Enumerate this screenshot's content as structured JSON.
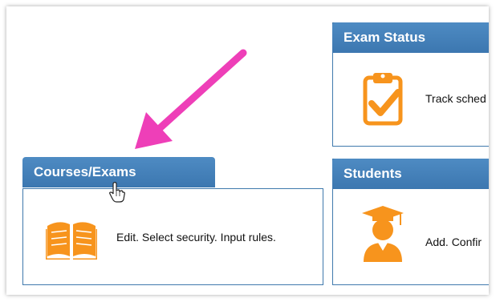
{
  "tiles": {
    "exam_status": {
      "title": "Exam Status",
      "description": "Track sched",
      "icon": "clipboard-check-icon"
    },
    "courses_exams": {
      "title": "Courses/Exams",
      "description": "Edit. Select security. Input rules.",
      "icon": "open-book-icon"
    },
    "students": {
      "title": "Students",
      "description": "Add. Confir",
      "icon": "graduate-icon"
    }
  },
  "colors": {
    "header": "#3c77b0",
    "border": "#3f79ad",
    "icon": "#f7941d",
    "arrow": "#ee3fb8"
  },
  "annotations": {
    "arrow": "pointer-arrow-annotation",
    "cursor": "hand-cursor-icon"
  }
}
